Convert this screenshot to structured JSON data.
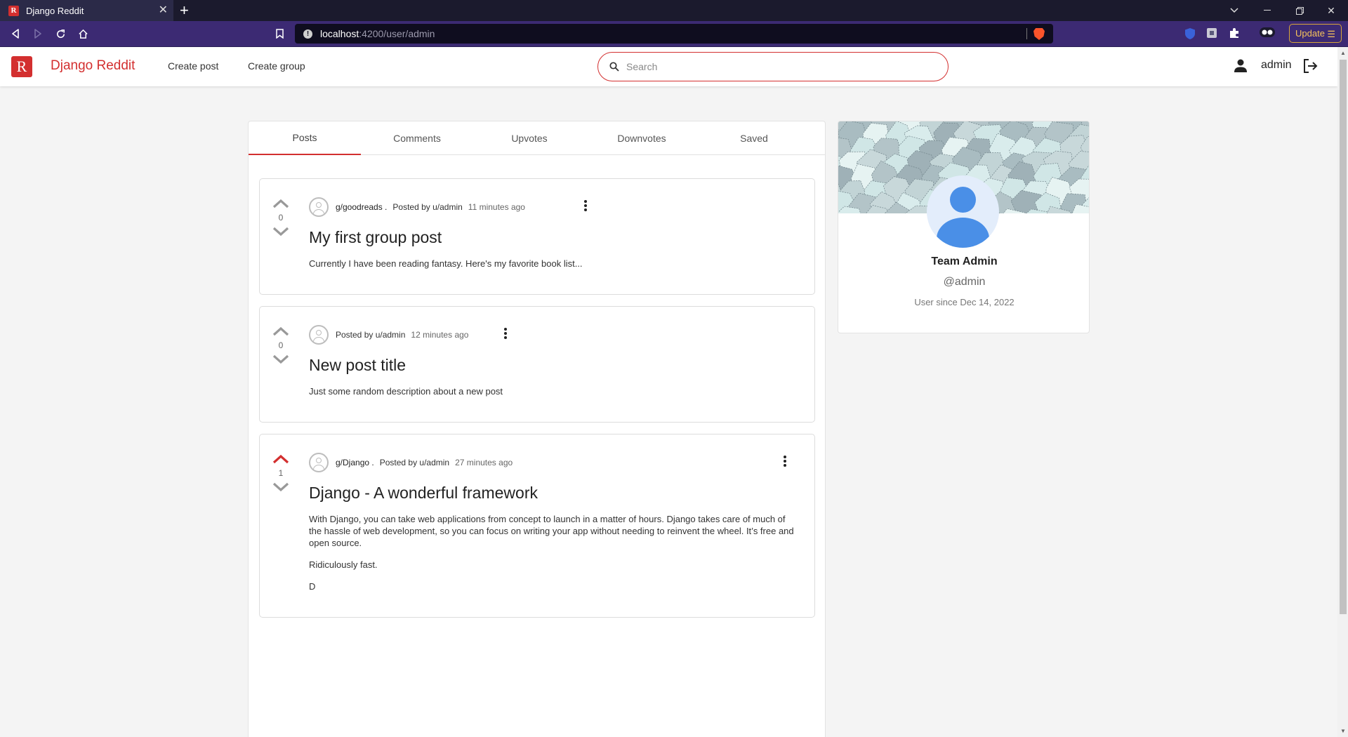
{
  "browser": {
    "tab_title": "Django Reddit",
    "tab_favicon": "R",
    "url_host": "localhost",
    "url_path": ":4200/user/admin",
    "update_label": "Update"
  },
  "app": {
    "logo_letter": "R",
    "brand": "Django Reddit",
    "nav": {
      "create_post": "Create post",
      "create_group": "Create group"
    },
    "search_placeholder": "Search",
    "username": "admin",
    "accent_color": "#d32f2f"
  },
  "tabs": [
    "Posts",
    "Comments",
    "Upvotes",
    "Downvotes",
    "Saved"
  ],
  "active_tab": "Posts",
  "posts": [
    {
      "vote_count": "0",
      "upvoted": false,
      "group": "g/goodreads .",
      "posted_by": "Posted by u/admin",
      "time": "11 minutes ago",
      "title": "My first group post",
      "body": [
        "Currently I have been reading fantasy. Here's my favorite book list..."
      ]
    },
    {
      "vote_count": "0",
      "upvoted": false,
      "group": "",
      "posted_by": "Posted by u/admin",
      "time": "12 minutes ago",
      "title": "New post title",
      "body": [
        "Just some random description about a new post"
      ]
    },
    {
      "vote_count": "1",
      "upvoted": true,
      "group": "g/Django .",
      "posted_by": "Posted by u/admin",
      "time": "27 minutes ago",
      "title": "Django - A wonderful framework",
      "body": [
        "With Django, you can take web applications from concept to launch in a matter of hours. Django takes care of much of the hassle of web development, so you can focus on writing your app without needing to reinvent the wheel. It’s free and open source.",
        "Ridiculously fast.",
        "D"
      ]
    }
  ],
  "profile": {
    "name": "Team Admin",
    "handle": "@admin",
    "since": "User since Dec 14, 2022"
  }
}
